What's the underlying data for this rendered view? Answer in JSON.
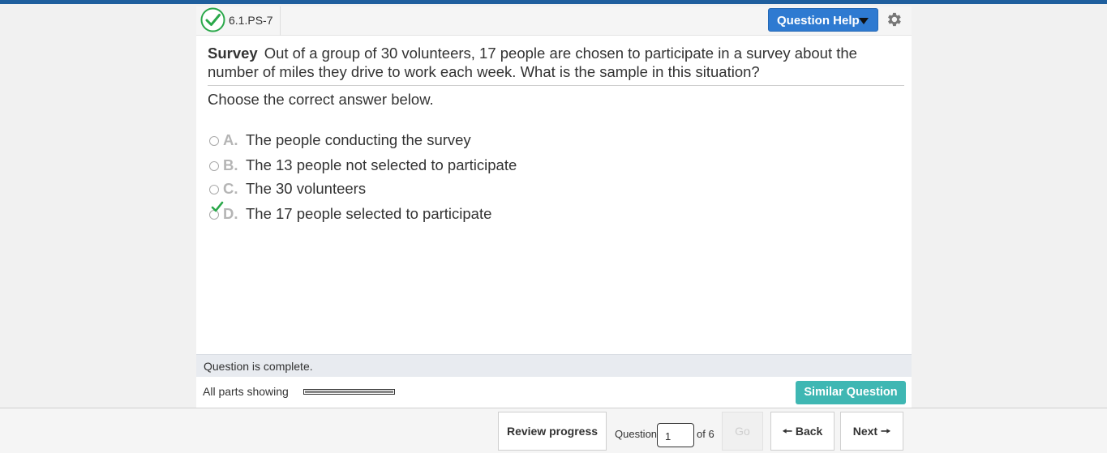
{
  "question": {
    "id": "6.1.PS-7",
    "tag": "Survey",
    "text": "Out of a group of 30 volunteers, 17 people are chosen to participate in a survey about the number of miles they drive to work each week. What is the sample in this situation?",
    "instruction": "Choose the correct answer below.",
    "choices": [
      {
        "letter": "A.",
        "text": "The people conducting the survey"
      },
      {
        "letter": "B.",
        "text": "The 13 people not selected to participate"
      },
      {
        "letter": "C.",
        "text": "The 30 volunteers"
      },
      {
        "letter": "D.",
        "text": "The 17 people selected to participate"
      }
    ],
    "selected_choice": "D"
  },
  "header": {
    "help_label": "Question Help"
  },
  "status": {
    "complete_text": "Question is complete.",
    "parts_text": "All parts showing",
    "parts_progress": 1.0,
    "similar_label": "Similar Question"
  },
  "footer": {
    "review_label": "Review progress",
    "question_label": "Question",
    "question_value": "1",
    "of_label": "of 6",
    "go_label": "Go",
    "back_label": "Back",
    "next_label": "Next"
  },
  "colors": {
    "accent": "#2e7ad1",
    "similar": "#3fb7b3",
    "check": "#2aa84a",
    "topbar": "#1f5f9e"
  }
}
